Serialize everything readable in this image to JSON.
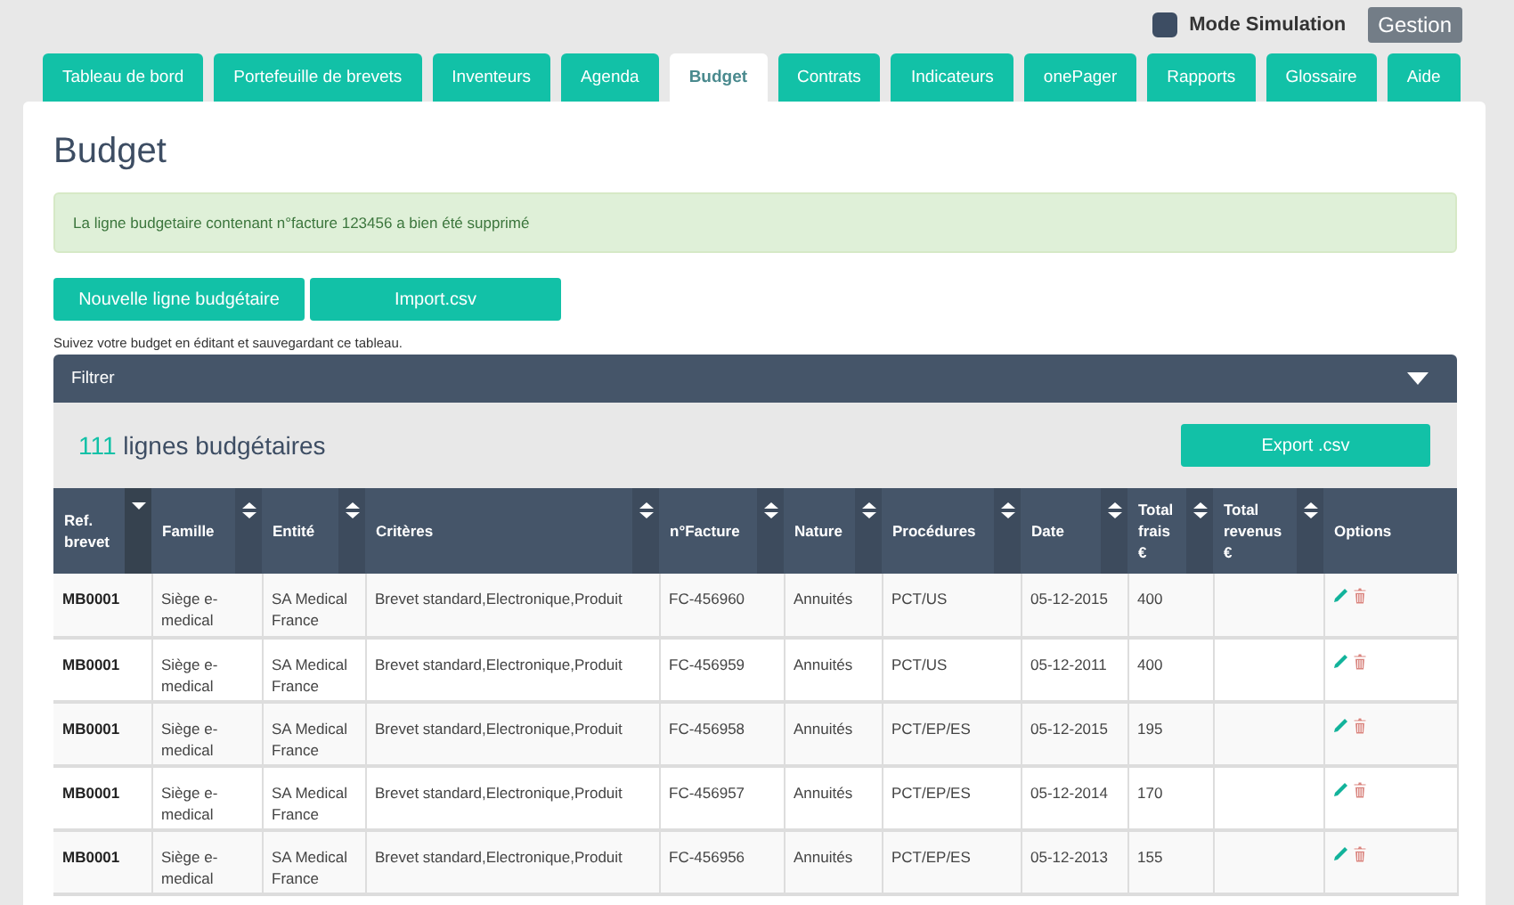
{
  "topbar": {
    "mode_simulation": {
      "label": "Mode Simulation",
      "checked": true
    },
    "gestion_button": "Gestion"
  },
  "tabs": [
    {
      "label": "Tableau de bord",
      "selected": false
    },
    {
      "label": "Portefeuille de brevets",
      "selected": false
    },
    {
      "label": "Inventeurs",
      "selected": false
    },
    {
      "label": "Agenda",
      "selected": false
    },
    {
      "label": "Budget",
      "selected": true
    },
    {
      "label": "Contrats",
      "selected": false
    },
    {
      "label": "Indicateurs",
      "selected": false
    },
    {
      "label": "onePager",
      "selected": false
    },
    {
      "label": "Rapports",
      "selected": false
    },
    {
      "label": "Glossaire",
      "selected": false
    },
    {
      "label": "Aide",
      "selected": false
    }
  ],
  "page": {
    "title": "Budget",
    "alert": "La ligne budgetaire contenant n°facture 123456 a bien été supprimé",
    "buttons": [
      "Nouvelle ligne budgétaire",
      "Import.csv"
    ],
    "hint": "Suivez votre budget en éditant et sauvegardant ce tableau.",
    "filter": {
      "label": "Filtrer",
      "expanded": false
    },
    "count": "111",
    "count_label": "lignes budgétaires",
    "export_button": "Export .csv"
  },
  "table": {
    "columns": [
      {
        "label": "Ref. brevet",
        "sortable": true,
        "sorted": true
      },
      {
        "label": "Famille",
        "sortable": true,
        "sorted": false
      },
      {
        "label": "Entité",
        "sortable": true,
        "sorted": false
      },
      {
        "label": "Critères",
        "sortable": true,
        "sorted": false
      },
      {
        "label": "n°Facture",
        "sortable": true,
        "sorted": false
      },
      {
        "label": "Nature",
        "sortable": true,
        "sorted": false
      },
      {
        "label": "Procédures",
        "sortable": true,
        "sorted": false
      },
      {
        "label": "Date",
        "sortable": true,
        "sorted": false
      },
      {
        "label": "Total frais €",
        "sortable": true,
        "sorted": false
      },
      {
        "label": "Total revenus €",
        "sortable": true,
        "sorted": false
      },
      {
        "label": "Options",
        "sortable": false
      }
    ],
    "rows": [
      [
        "MB0001",
        "Siège e-medical",
        "SA Medical France",
        "Brevet standard,Electronique,Produit",
        "FC-456960",
        "Annuités",
        "PCT/US",
        "05-12-2015",
        "400"
      ],
      [
        "MB0001",
        "Siège e-medical",
        "SA Medical France",
        "Brevet standard,Electronique,Produit",
        "FC-456959",
        "Annuités",
        "PCT/US",
        "05-12-2011",
        "400"
      ],
      [
        "MB0001",
        "Siège e-medical",
        "SA Medical France",
        "Brevet standard,Electronique,Produit",
        "FC-456958",
        "Annuités",
        "PCT/EP/ES",
        "05-12-2015",
        "195"
      ],
      [
        "MB0001",
        "Siège e-medical",
        "SA Medical France",
        "Brevet standard,Electronique,Produit",
        "FC-456957",
        "Annuités",
        "PCT/EP/ES",
        "05-12-2014",
        "170"
      ],
      [
        "MB0001",
        "Siège e-medical",
        "SA Medical France",
        "Brevet standard,Electronique,Produit",
        "FC-456956",
        "Annuités",
        "PCT/EP/ES",
        "05-12-2013",
        "155"
      ]
    ]
  }
}
